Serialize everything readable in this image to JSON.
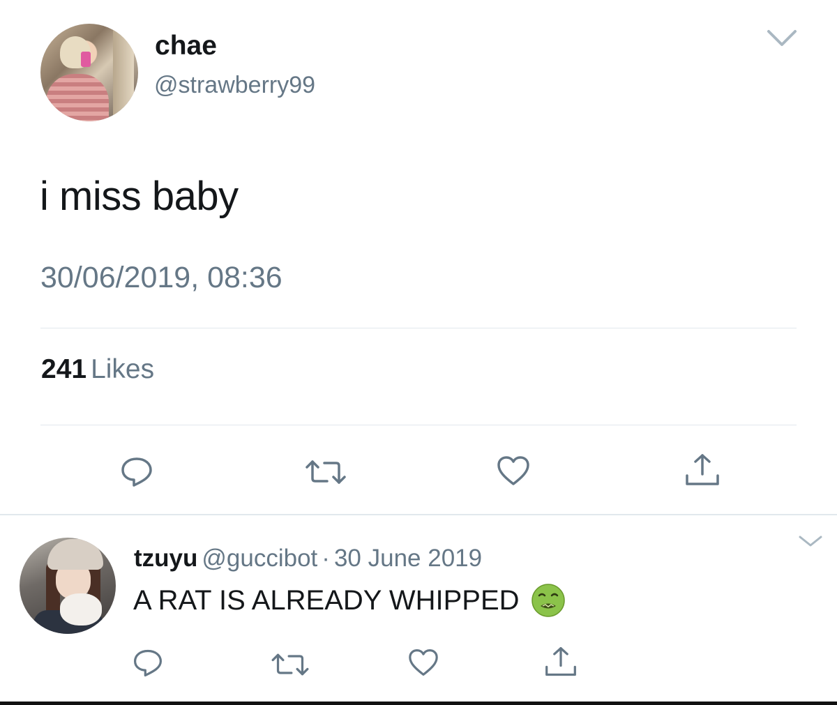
{
  "tweet": {
    "author": {
      "display_name": "chae",
      "handle": "@strawberry99",
      "avatar_icon": "profile-photo"
    },
    "text": "i miss baby",
    "timestamp": "30/06/2019, 08:36",
    "likes": {
      "count": "241",
      "label": "Likes"
    },
    "actions": [
      "reply-icon",
      "retweet-icon",
      "like-icon",
      "share-icon"
    ]
  },
  "reply": {
    "author": {
      "display_name": "tzuyu",
      "handle": "@guccibot",
      "avatar_icon": "profile-photo"
    },
    "separator": "·",
    "date": "30 June 2019",
    "text": "A RAT IS ALREADY WHIPPED",
    "emoji": "nauseated-face-emoji",
    "actions": [
      "reply-icon",
      "retweet-icon",
      "like-icon",
      "share-icon"
    ]
  },
  "colors": {
    "primary_text": "#14171a",
    "secondary_text": "#657786",
    "divider": "#e1e8ed",
    "icon": "#657786"
  }
}
